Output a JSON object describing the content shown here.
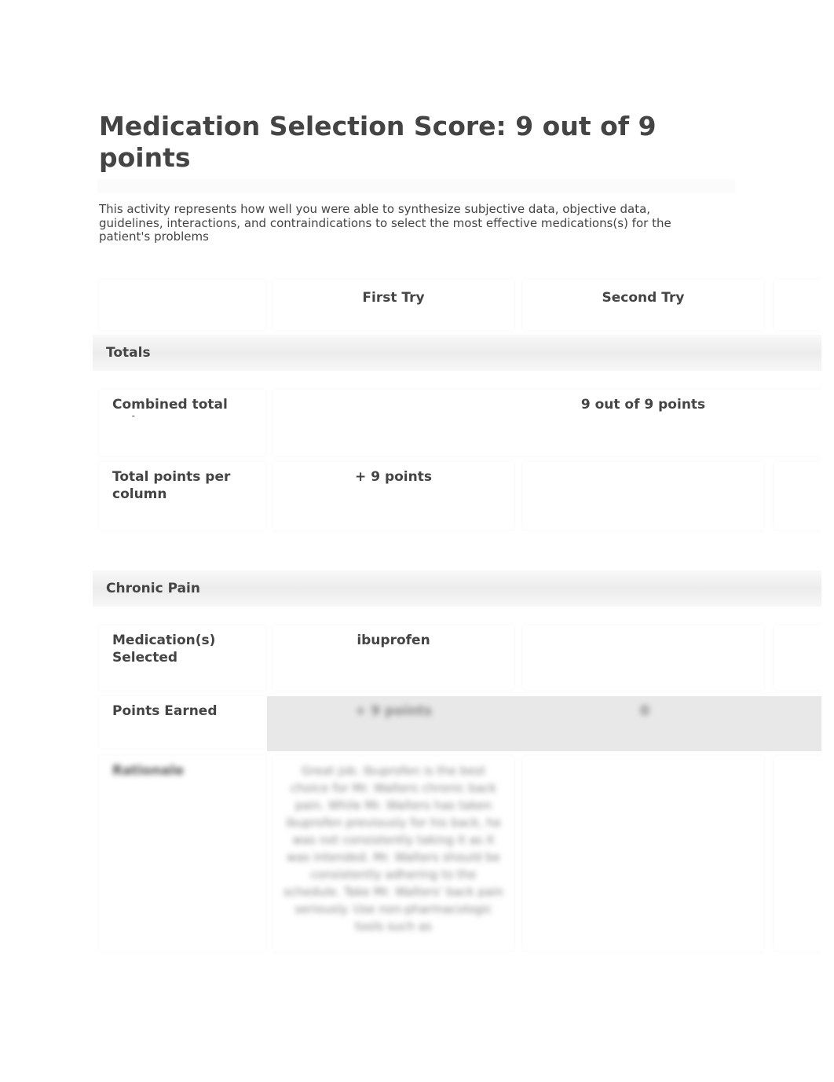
{
  "page": {
    "title": "Medication Selection Score: 9 out of 9 points",
    "intro": "This activity represents how well you were able to synthesize subjective data, objective data, guidelines, interactions, and contraindications to select the most effective medications(s) for the patient's problems"
  },
  "table": {
    "columns": [
      "",
      "First Try",
      "Second Try",
      ""
    ],
    "totals": {
      "section_label": "Totals",
      "combined_label": "Combined total points",
      "combined_first": "",
      "combined_second": "9 out of 9 points",
      "per_column_label": "Total points per column",
      "per_column_first": "+ 9 points",
      "per_column_second": ""
    },
    "problems": [
      {
        "section_label": "Chronic Pain",
        "medications_label": "Medication(s) Selected",
        "medications_first": "ibuprofen",
        "medications_second": "",
        "points_label": "Points Earned",
        "points_first": "+ 9 points",
        "points_second": "0",
        "rationale_label": "Rationale",
        "rationale_first": "Great job. Ibuprofen is the best choice for Mr. Walters chronic back pain. While Mr. Walters has taken ibuprofen previously for his back, he was not consistently taking it as it was intended. Mr. Walters should be consistently adhering to the schedule. Take Mr. Walters' back pain seriously. Use non-pharmacologic tools such as",
        "rationale_second": ""
      }
    ]
  }
}
